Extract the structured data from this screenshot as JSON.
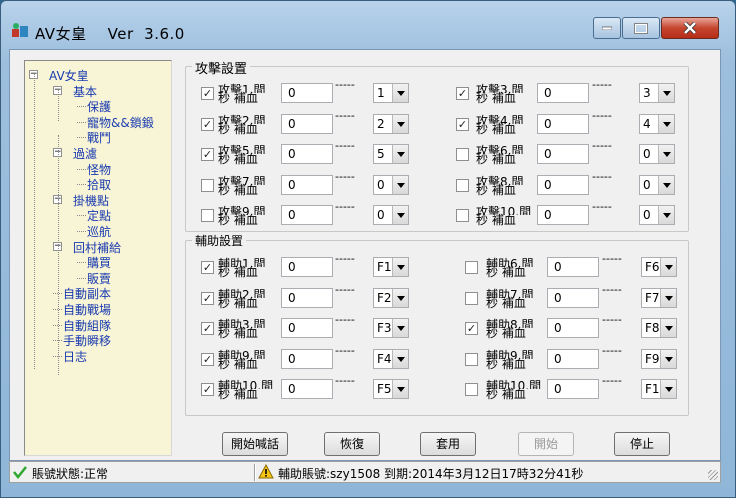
{
  "window": {
    "title": "AV女皇    Ver  3.6.0"
  },
  "tree": [
    {
      "label": "AV女皇",
      "level": 0,
      "expander": "−"
    },
    {
      "label": "基本",
      "level": 1,
      "expander": "−"
    },
    {
      "label": "保護",
      "level": 2
    },
    {
      "label": "寵物&&鎖鍛",
      "level": 2
    },
    {
      "label": "戰鬥",
      "level": 2
    },
    {
      "label": "過濾",
      "level": 1,
      "expander": "−"
    },
    {
      "label": "怪物",
      "level": 2
    },
    {
      "label": "拾取",
      "level": 2
    },
    {
      "label": "掛機點",
      "level": 1,
      "expander": "−"
    },
    {
      "label": "定點",
      "level": 2
    },
    {
      "label": "巡航",
      "level": 2
    },
    {
      "label": "回村補給",
      "level": 1,
      "expander": "−"
    },
    {
      "label": "購買",
      "level": 2
    },
    {
      "label": "販賣",
      "level": 2
    },
    {
      "label": "自動副本",
      "level": 1
    },
    {
      "label": "自動戰場",
      "level": 1
    },
    {
      "label": "自動組隊",
      "level": 1
    },
    {
      "label": "手動瞬移",
      "level": 1
    },
    {
      "label": "日志",
      "level": 1
    }
  ],
  "attack": {
    "title": "攻擊設置",
    "dashes": "-----",
    "slots": [
      {
        "l1": "攻擊1,間",
        "l2": "秒 補血",
        "checked": true,
        "value": "0",
        "select": "1"
      },
      {
        "l1": "攻擊2,間",
        "l2": "秒 補血",
        "checked": true,
        "value": "0",
        "select": "2"
      },
      {
        "l1": "攻擊5,間",
        "l2": "秒 補血",
        "checked": true,
        "value": "0",
        "select": "5"
      },
      {
        "l1": "攻擊7,間",
        "l2": "秒 補血",
        "checked": false,
        "value": "0",
        "select": "0"
      },
      {
        "l1": "攻擊9,間",
        "l2": "秒 補血",
        "checked": false,
        "value": "0",
        "select": "0"
      },
      {
        "l1": "攻擊3,間",
        "l2": "秒 補血",
        "checked": true,
        "value": "0",
        "select": "3"
      },
      {
        "l1": "攻擊4,間",
        "l2": "秒 補血",
        "checked": true,
        "value": "0",
        "select": "4"
      },
      {
        "l1": "攻擊6,間",
        "l2": "秒 補血",
        "checked": false,
        "value": "0",
        "select": "0"
      },
      {
        "l1": "攻擊8,間",
        "l2": "秒 補血",
        "checked": false,
        "value": "0",
        "select": "0"
      },
      {
        "l1": "攻擊10,間",
        "l2": "秒 補血",
        "checked": false,
        "value": "0",
        "select": "0"
      }
    ]
  },
  "assist": {
    "title": "輔助設置",
    "dashes": "-----",
    "slots": [
      {
        "l1": "輔助1,間",
        "l2": "秒 補血",
        "checked": true,
        "value": "0",
        "select": "F1"
      },
      {
        "l1": "輔助2,間",
        "l2": "秒 補血",
        "checked": true,
        "value": "0",
        "select": "F2"
      },
      {
        "l1": "輔助3,間",
        "l2": "秒 補血",
        "checked": true,
        "value": "0",
        "select": "F3"
      },
      {
        "l1": "輔助9,間",
        "l2": "秒 補血",
        "checked": true,
        "value": "0",
        "select": "F4"
      },
      {
        "l1": "輔助10,間",
        "l2": "秒 補血",
        "checked": true,
        "value": "0",
        "select": "F5"
      },
      {
        "l1": "輔助6,間",
        "l2": "秒 補血",
        "checked": false,
        "value": "0",
        "select": "F6"
      },
      {
        "l1": "輔助7,間",
        "l2": "秒 補血",
        "checked": false,
        "value": "0",
        "select": "F7"
      },
      {
        "l1": "輔助8,間",
        "l2": "秒 補血",
        "checked": true,
        "value": "0",
        "select": "F8"
      },
      {
        "l1": "輔助9,間",
        "l2": "秒 補血",
        "checked": false,
        "value": "0",
        "select": "F9"
      },
      {
        "l1": "輔助10,間",
        "l2": "秒 補血",
        "checked": false,
        "value": "0",
        "select": "F1"
      }
    ]
  },
  "buttons": {
    "start_shout": "開始喊話",
    "restore": "恢復",
    "apply": "套用",
    "start": "開始",
    "stop": "停止"
  },
  "status": {
    "account": "賬號狀態:正常",
    "assist_account": "輔助賬號:szy1508  到期:2014年3月12日17時32分41秒"
  }
}
